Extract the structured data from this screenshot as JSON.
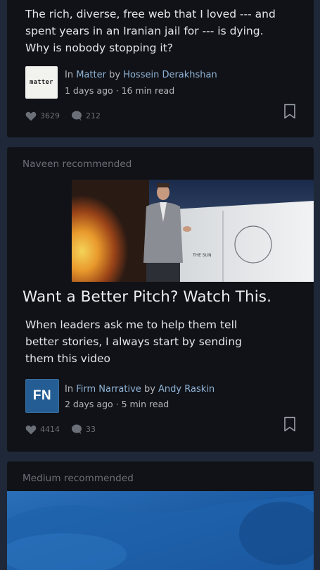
{
  "posts": [
    {
      "excerpt": "The rich, diverse, free web that I loved --- and spent years in an Iranian jail for --- is dying. Why is nobody stopping it?",
      "logo_text": "matter",
      "in_label": "In",
      "publication": "Matter",
      "by_label": "by",
      "author": "Hossein Derakhshan",
      "meta": "1 days ago · 16 min read",
      "likes": "3629",
      "responses": "212"
    },
    {
      "recommended_by": "Naveen recommended",
      "image_caption": "THE SUN",
      "title": "Want a Better Pitch? Watch This.",
      "excerpt": "When leaders ask me to help them tell better stories, I always start by sending them this video",
      "logo_text": "FN",
      "in_label": "In",
      "publication": "Firm Narrative",
      "by_label": "by",
      "author": "Andy Raskin",
      "meta": "2 days ago · 5 min read",
      "likes": "4414",
      "responses": "33"
    },
    {
      "recommended_by": "Medium  recommended"
    }
  ],
  "colors": {
    "background": "#1e2838",
    "card": "#111217",
    "link": "#8fb3d6",
    "muted": "#6b7078"
  },
  "icons": {
    "like": "heart-icon",
    "response": "speech-bubble-icon",
    "bookmark": "bookmark-icon"
  }
}
